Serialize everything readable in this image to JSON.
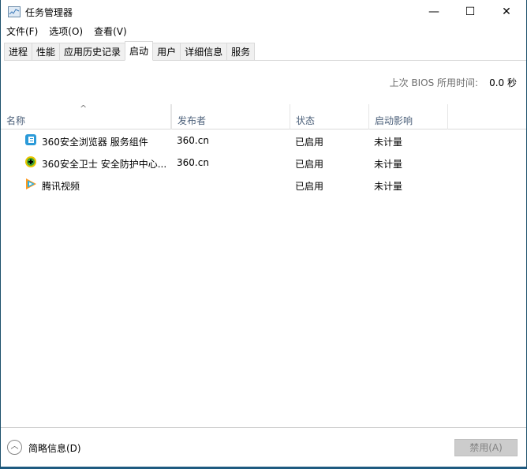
{
  "window": {
    "title": "任务管理器",
    "minimize": "—",
    "maximize": "☐",
    "close": "✕"
  },
  "menu": [
    "文件(F)",
    "选项(O)",
    "查看(V)"
  ],
  "tabs": [
    "进程",
    "性能",
    "应用历史记录",
    "启动",
    "用户",
    "详细信息",
    "服务"
  ],
  "active_tab": "启动",
  "bios": {
    "label": "上次 BIOS 所用时间:",
    "value": "0.0 秒"
  },
  "columns": [
    "名称",
    "发布者",
    "状态",
    "启动影响"
  ],
  "rows": [
    {
      "name": "360安全浏览器 服务组件",
      "publisher": "360.cn",
      "status": "已启用",
      "impact": "未计量",
      "icon": "360-browser-icon"
    },
    {
      "name": "360安全卫士 安全防护中心...",
      "publisher": "360.cn",
      "status": "已启用",
      "impact": "未计量",
      "icon": "360-safe-icon"
    },
    {
      "name": "腾讯视频",
      "publisher": "",
      "status": "已启用",
      "impact": "未计量",
      "icon": "tencent-video-icon"
    }
  ],
  "footer": {
    "less_details": "简略信息(D)",
    "disable_button": "禁用(A)"
  }
}
